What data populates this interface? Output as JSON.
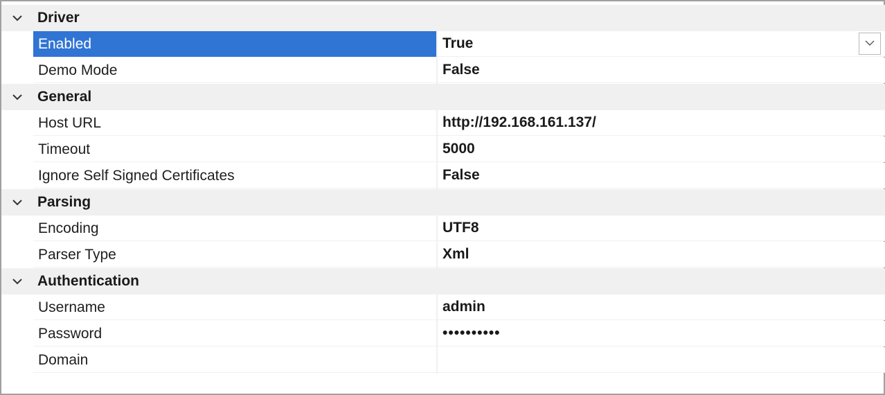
{
  "categories": [
    {
      "label": "Driver",
      "properties": [
        {
          "name": "Enabled",
          "value": "True"
        },
        {
          "name": "Demo Mode",
          "value": "False"
        }
      ]
    },
    {
      "label": "General",
      "properties": [
        {
          "name": "Host URL",
          "value": "http://192.168.161.137/"
        },
        {
          "name": "Timeout",
          "value": "5000"
        },
        {
          "name": "Ignore Self Signed Certificates",
          "value": "False"
        }
      ]
    },
    {
      "label": "Parsing",
      "properties": [
        {
          "name": "Encoding",
          "value": "UTF8"
        },
        {
          "name": "Parser Type",
          "value": "Xml"
        }
      ]
    },
    {
      "label": "Authentication",
      "properties": [
        {
          "name": "Username",
          "value": "admin"
        },
        {
          "name": "Password",
          "value": "••••••••••"
        },
        {
          "name": "Domain",
          "value": ""
        }
      ]
    }
  ],
  "colors": {
    "selection": "#3074d4",
    "category_background": "#f0f0f0"
  }
}
